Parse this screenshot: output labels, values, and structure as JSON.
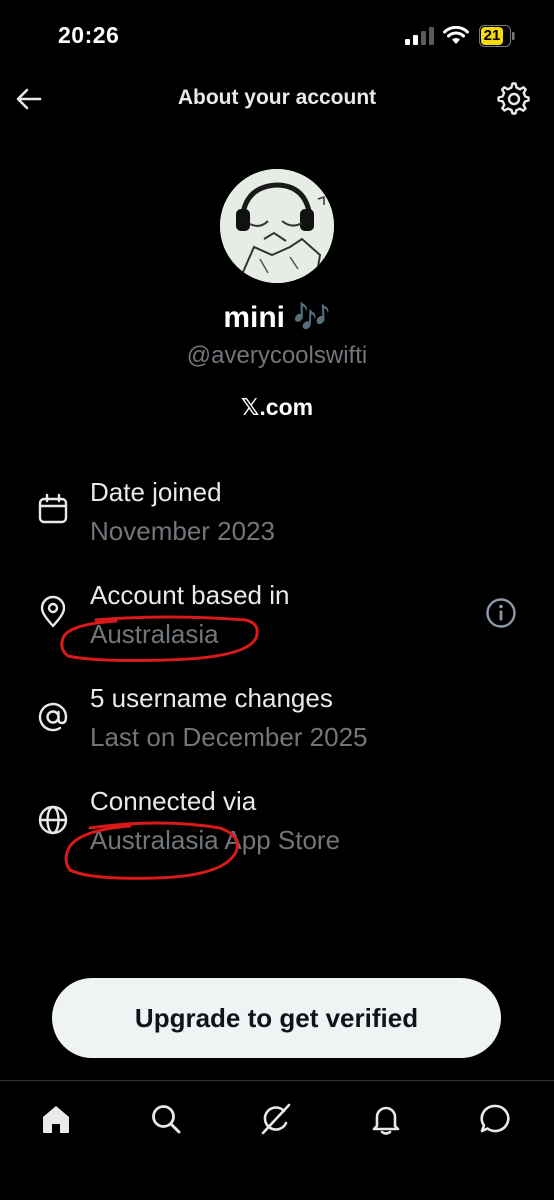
{
  "status_bar": {
    "time": "20:26",
    "battery": "21"
  },
  "header": {
    "title": "About your account",
    "back_icon": "arrow-left-icon",
    "settings_icon": "gear-icon"
  },
  "profile": {
    "display_name": "mini 🎶",
    "handle": "@averycoolswifti",
    "site": "𝕏.com"
  },
  "rows": [
    {
      "icon": "calendar-icon",
      "title": "Date joined",
      "subtitle": "November 2023"
    },
    {
      "icon": "location-pin-icon",
      "title": "Account based in",
      "subtitle": "Australasia"
    },
    {
      "icon": "at-sign-icon",
      "title": "5 username changes",
      "subtitle": "Last on December 2025"
    },
    {
      "icon": "globe-icon",
      "title": "Connected via",
      "subtitle": "Australasia App Store"
    }
  ],
  "upgrade_button": {
    "label": "Upgrade to get verified"
  },
  "tabs": [
    "home-icon",
    "search-icon",
    "grok-icon",
    "notifications-icon",
    "messages-icon"
  ],
  "colors": {
    "background": "#000000",
    "primary_text": "#e7e9ea",
    "secondary_text": "#71767b",
    "button_bg": "#eff3f4",
    "annotation": "#d91a1a",
    "battery": "#f5d90a"
  }
}
